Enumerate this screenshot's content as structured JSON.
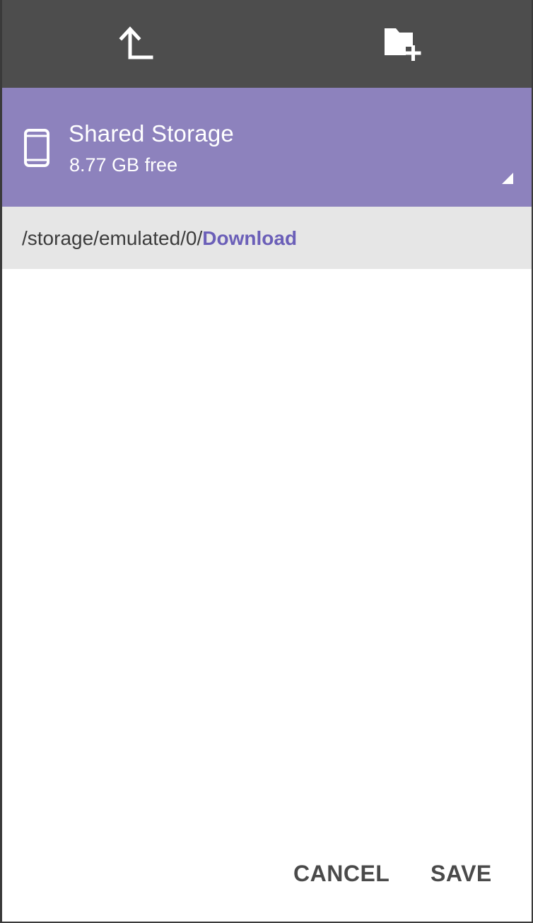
{
  "toolbar": {
    "up_icon": "arrow-up-left-corner-icon",
    "new_folder_icon": "new-folder-icon"
  },
  "storage": {
    "name": "Shared Storage",
    "free": "8.77 GB free",
    "device_icon": "smartphone-icon",
    "background_color": "#8d82bd"
  },
  "path": {
    "prefix": "/storage/emulated/0/",
    "current": "Download",
    "current_color": "#6b5fb8"
  },
  "actions": {
    "cancel_label": "CANCEL",
    "save_label": "SAVE"
  }
}
